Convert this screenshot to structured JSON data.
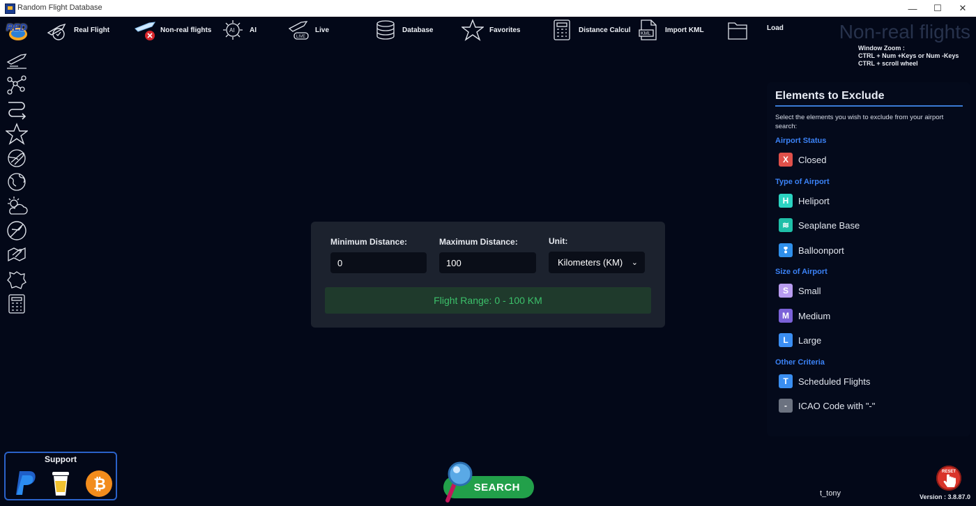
{
  "window": {
    "title": "Random Flight Database",
    "controls": {
      "minimize": "—",
      "maximize": "☐",
      "close": "✕"
    }
  },
  "toolbar": {
    "logo_text": "RED",
    "items": [
      {
        "label": "Real Flight",
        "icon": "plane-takeoff-icon"
      },
      {
        "label": "Non-real flights",
        "icon": "plane-cancel-icon"
      },
      {
        "label": "AI",
        "icon": "ai-chip-icon"
      },
      {
        "label": "Live",
        "icon": "plane-live-icon"
      },
      {
        "label": "Database",
        "icon": "database-icon"
      },
      {
        "label": "Favorites",
        "icon": "star-icon"
      },
      {
        "label": "Distance Calcul",
        "icon": "calculator-icon"
      },
      {
        "label": "Import KML",
        "icon": "kml-file-icon"
      },
      {
        "label": "Load",
        "icon": "folder-icon"
      }
    ]
  },
  "sidebar": {
    "icons": [
      "flight-icon",
      "route-nodes-icon",
      "path-icon",
      "star-icon",
      "globe-plane-icon",
      "world-icon",
      "weather-icon",
      "no-fly-icon",
      "map-plane-icon",
      "region-map-icon",
      "calculator-icon"
    ]
  },
  "header": {
    "mode_title": "Non-real flights",
    "zoom_help": [
      "Window Zoom :",
      "CTRL + Num +Keys or Num -Keys",
      "CTRL + scroll wheel"
    ]
  },
  "exclude": {
    "title": "Elements to Exclude",
    "description": "Select the elements you wish to exclude from your airport search:",
    "sections": [
      {
        "title": "Airport Status",
        "options": [
          {
            "badge": "X",
            "label": "Closed",
            "color": "#e0504a"
          }
        ]
      },
      {
        "title": "Type of Airport",
        "options": [
          {
            "badge": "H",
            "label": "Heliport",
            "color": "#2bd3c2"
          },
          {
            "badge": "≋",
            "label": "Seaplane Base",
            "color": "#1fbfa8"
          },
          {
            "badge": "❢",
            "label": "Balloonport",
            "color": "#2f8fea"
          }
        ]
      },
      {
        "title": "Size of Airport",
        "options": [
          {
            "badge": "S",
            "label": "Small",
            "color": "#b89cf0"
          },
          {
            "badge": "M",
            "label": "Medium",
            "color": "#7b62d8"
          },
          {
            "badge": "L",
            "label": "Large",
            "color": "#3b8ef2"
          }
        ]
      },
      {
        "title": "Other Criteria",
        "options": [
          {
            "badge": "T",
            "label": "Scheduled Flights",
            "color": "#3a8ef0"
          },
          {
            "badge": "-",
            "label": "ICAO Code with \"-\"",
            "color": "#6b7280"
          }
        ]
      }
    ]
  },
  "range": {
    "min_label": "Minimum Distance:",
    "min_value": "0",
    "max_label": "Maximum Distance:",
    "max_value": "100",
    "unit_label": "Unit:",
    "unit_value": "Kilometers (KM)",
    "result": "Flight Range: 0 - 100 KM"
  },
  "support": {
    "title": "Support",
    "icons": [
      "paypal-icon",
      "coffee-cup-icon",
      "bitcoin-icon"
    ]
  },
  "search": {
    "label": "SEARCH"
  },
  "reset": {
    "label": "RESET"
  },
  "user": {
    "name": "t_tony"
  },
  "version": "Version : 3.8.87.0",
  "colors": {
    "accent": "#3b82f6",
    "success": "#3cc06a",
    "background": "#030818",
    "card": "#1c222e"
  }
}
